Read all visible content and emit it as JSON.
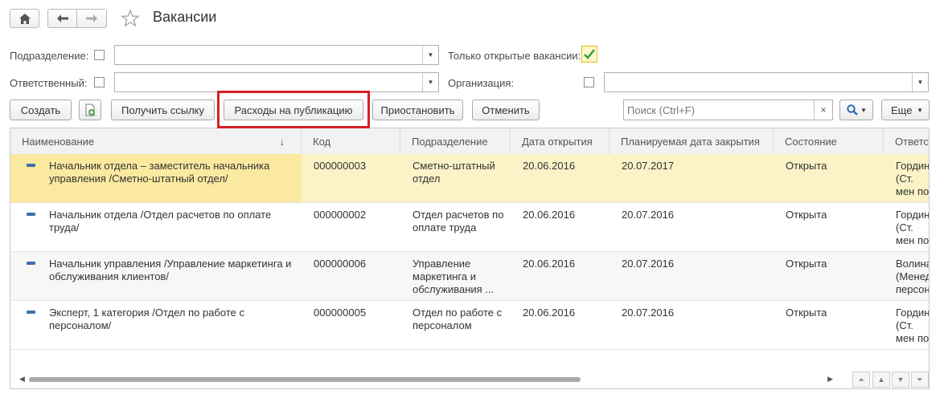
{
  "window": {
    "title": "Вакансии"
  },
  "filters": {
    "department_label": "Подразделение:",
    "department_value": "",
    "responsible_label": "Ответственный:",
    "responsible_value": "",
    "only_open_label": "Только открытые вакансии:",
    "only_open_checked": true,
    "organization_label": "Организация:",
    "organization_value": ""
  },
  "toolbar": {
    "create": "Создать",
    "get_link": "Получить ссылку",
    "publication_costs": "Расходы на публикацию",
    "suspend": "Приостановить",
    "cancel": "Отменить",
    "search_placeholder": "Поиск (Ctrl+F)",
    "more": "Еще"
  },
  "table": {
    "columns": [
      "Наименование",
      "Код",
      "Подразделение",
      "Дата открытия",
      "Планируемая дата закрытия",
      "Состояние",
      "Ответс"
    ],
    "sort_indicator": "↓",
    "rows": [
      {
        "name": "Начальник отдела – заместитель начальника управления /Сметно-штатный отдел/",
        "code": "000000003",
        "department": "Сметно-штатный отдел",
        "opened": "20.06.2016",
        "planned_close": "20.07.2017",
        "state": "Открыта",
        "responsible": "Гордин (Ст. мен по персо"
      },
      {
        "name": "Начальник отдела /Отдел расчетов по оплате труда/",
        "code": "000000002",
        "department": "Отдел расчетов по оплате труда",
        "opened": "20.06.2016",
        "planned_close": "20.07.2016",
        "state": "Открыта",
        "responsible": "Гордин (Ст. мен по персо"
      },
      {
        "name": "Начальник управления /Управление маркетинга и обслуживания клиентов/",
        "code": "000000006",
        "department": "Управление маркетинга и обслуживания ...",
        "opened": "20.06.2016",
        "planned_close": "20.07.2016",
        "state": "Открыта",
        "responsible": "Волина (Менед персон"
      },
      {
        "name": "Эксперт, 1 категория /Отдел по работе с персоналом/",
        "code": "000000005",
        "department": "Отдел по работе с персоналом",
        "opened": "20.06.2016",
        "planned_close": "20.07.2016",
        "state": "Открыта",
        "responsible": "Гордин (Ст. мен по персо"
      }
    ]
  },
  "colors": {
    "highlight": "#d61f26",
    "selected_row": "#fbf3c7",
    "check": "#2e9e3a"
  },
  "icons": [
    "home-icon",
    "back-icon",
    "forward-icon",
    "star-icon",
    "add-document-icon",
    "clear-icon",
    "search-icon",
    "row-item-icon"
  ]
}
